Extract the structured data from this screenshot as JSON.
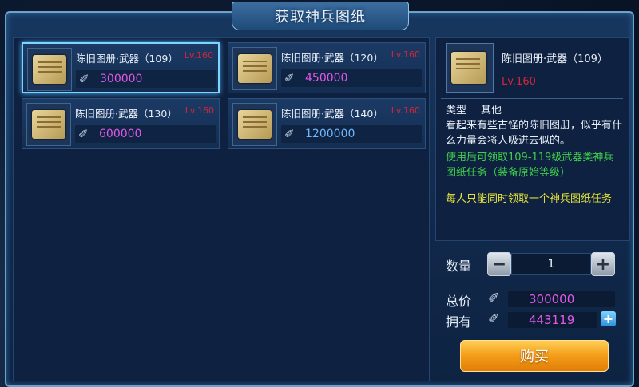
{
  "window": {
    "title": "获取神兵图纸"
  },
  "items": [
    {
      "name": "陈旧图册·武器（109）",
      "level": "Lv.160",
      "price": "300000",
      "price_color": "#e058e8",
      "icon": "scroll-icon",
      "selected": true
    },
    {
      "name": "陈旧图册·武器（120）",
      "level": "Lv.160",
      "price": "450000",
      "price_color": "#e058e8",
      "icon": "scroll-icon",
      "selected": false
    },
    {
      "name": "陈旧图册·武器（130）",
      "level": "Lv.160",
      "price": "600000",
      "price_color": "#e058e8",
      "icon": "scroll-icon",
      "selected": false
    },
    {
      "name": "陈旧图册·武器（140）",
      "level": "Lv.160",
      "price": "1200000",
      "price_color": "#6fb6ff",
      "icon": "scroll-icon",
      "selected": false
    }
  ],
  "detail": {
    "name": "陈旧图册·武器（109）",
    "level": "Lv.160",
    "type_label": "类型",
    "type_value": "其他",
    "lore": "看起来有些古怪的陈旧图册，似乎有什么力量会将人吸进去似的。",
    "use_text": "使用后可领取109-119级武器类神兵图纸任务（装备原始等级）",
    "limit_text": "每人只能同时领取一个神兵图纸任务"
  },
  "purchase": {
    "quantity_label": "数量",
    "quantity": "1",
    "minus": "−",
    "plus": "+",
    "total_label": "总价",
    "total": "300000",
    "owned_label": "拥有",
    "owned": "443119",
    "buy_label": "购买"
  },
  "colors": {
    "level": "#d8243a",
    "currency": "#e058e8",
    "green_text": "#3ecf4b",
    "yellow_text": "#e6e43a",
    "buy_button": "#f49c18"
  }
}
